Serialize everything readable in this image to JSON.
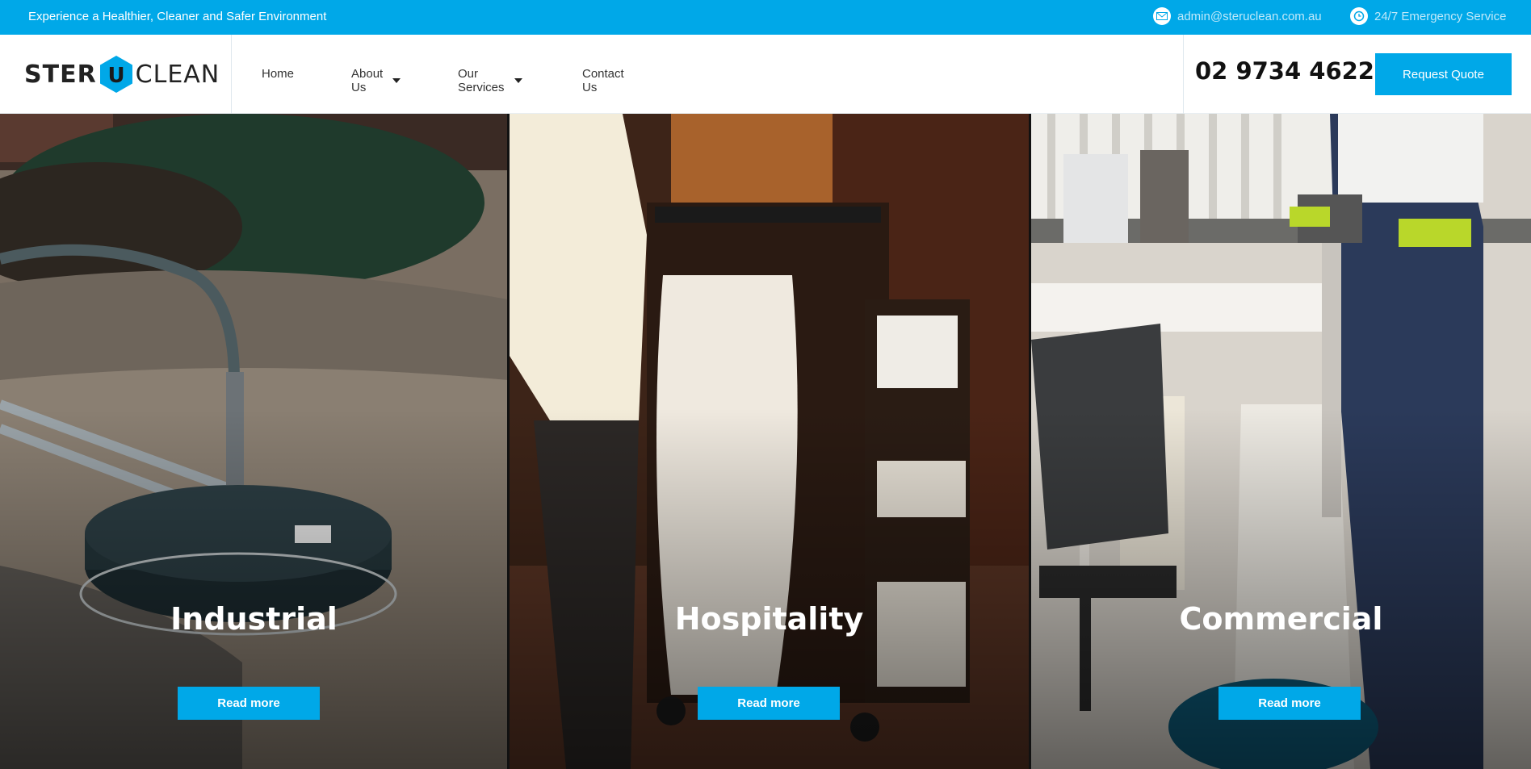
{
  "topbar": {
    "tagline": "Experience a Healthier, Cleaner and Safer Environment",
    "email": "admin@steruclean.com.au",
    "emergency": "24/7 Emergency Service",
    "email_icon": "envelope-icon",
    "emergency_icon": "clock-icon"
  },
  "brand": {
    "part1": "STER",
    "mark": "U",
    "part2": "CLEAN"
  },
  "nav": {
    "items": [
      {
        "label": "Home",
        "has_dropdown": false
      },
      {
        "label": "About Us",
        "has_dropdown": true
      },
      {
        "label": "Our Services",
        "has_dropdown": true
      },
      {
        "label": "Contact Us",
        "has_dropdown": false
      }
    ]
  },
  "header": {
    "phone": "02 9734 4622",
    "quote_label": "Request Quote"
  },
  "panels": [
    {
      "title": "Industrial",
      "button": "Read more"
    },
    {
      "title": "Hospitality",
      "button": "Read more"
    },
    {
      "title": "Commercial",
      "button": "Read more"
    }
  ],
  "colors": {
    "accent": "#00a8e8",
    "text_dark": "#222222"
  }
}
